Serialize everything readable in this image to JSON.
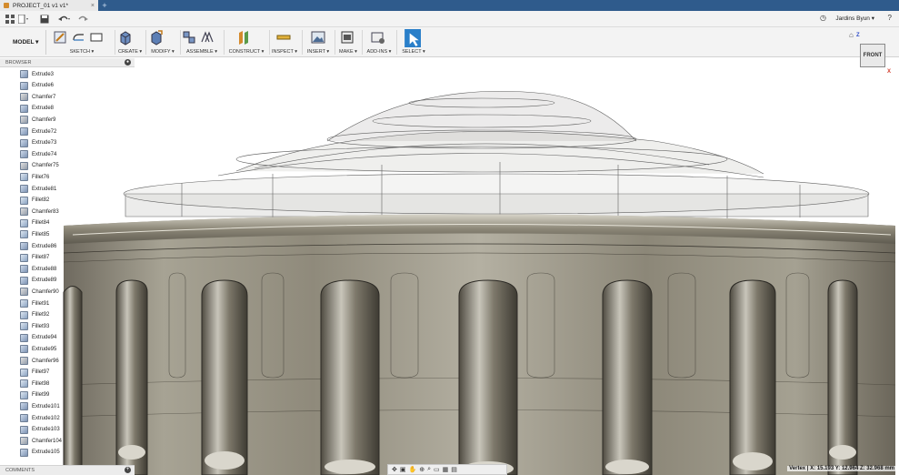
{
  "title_bar": {
    "document_tab": "PROJECT_01 v1 v1*",
    "tab_close": "×",
    "new_tab": "+"
  },
  "quick_access": {
    "user_name": "Jardins Byun ▾",
    "help": "?",
    "clock": "◷"
  },
  "ribbon": {
    "workspace": "MODEL ▾",
    "groups": [
      {
        "label": "SKETCH ▾"
      },
      {
        "label": "CREATE ▾"
      },
      {
        "label": "MODIFY ▾"
      },
      {
        "label": "ASSEMBLE ▾"
      },
      {
        "label": "CONSTRUCT ▾"
      },
      {
        "label": "INSPECT ▾"
      },
      {
        "label": "INSERT ▾"
      },
      {
        "label": "MAKE ▾"
      },
      {
        "label": "ADD-INS ▾"
      },
      {
        "label": "SELECT ▾"
      }
    ]
  },
  "browser": {
    "title": "BROWSER",
    "items": [
      {
        "label": "Extrude3",
        "kind": "extrude"
      },
      {
        "label": "Extrude6",
        "kind": "extrude"
      },
      {
        "label": "Chamfer7",
        "kind": "chamfer"
      },
      {
        "label": "Extrude8",
        "kind": "extrude"
      },
      {
        "label": "Chamfer9",
        "kind": "chamfer"
      },
      {
        "label": "Extrude72",
        "kind": "extrude"
      },
      {
        "label": "Extrude73",
        "kind": "extrude"
      },
      {
        "label": "Extrude74",
        "kind": "extrude"
      },
      {
        "label": "Chamfer75",
        "kind": "chamfer"
      },
      {
        "label": "Fillet76",
        "kind": "fillet"
      },
      {
        "label": "Extrude81",
        "kind": "extrude"
      },
      {
        "label": "Fillet82",
        "kind": "fillet"
      },
      {
        "label": "Chamfer83",
        "kind": "chamfer"
      },
      {
        "label": "Fillet84",
        "kind": "fillet"
      },
      {
        "label": "Fillet85",
        "kind": "fillet"
      },
      {
        "label": "Extrude86",
        "kind": "extrude"
      },
      {
        "label": "Fillet87",
        "kind": "fillet"
      },
      {
        "label": "Extrude88",
        "kind": "extrude"
      },
      {
        "label": "Extrude89",
        "kind": "extrude"
      },
      {
        "label": "Chamfer90",
        "kind": "chamfer"
      },
      {
        "label": "Fillet91",
        "kind": "fillet"
      },
      {
        "label": "Fillet92",
        "kind": "fillet"
      },
      {
        "label": "Fillet93",
        "kind": "fillet"
      },
      {
        "label": "Extrude94",
        "kind": "extrude"
      },
      {
        "label": "Extrude95",
        "kind": "extrude"
      },
      {
        "label": "Chamfer96",
        "kind": "chamfer"
      },
      {
        "label": "Fillet97",
        "kind": "fillet"
      },
      {
        "label": "Fillet98",
        "kind": "fillet"
      },
      {
        "label": "Fillet99",
        "kind": "fillet"
      },
      {
        "label": "Extrude101",
        "kind": "extrude"
      },
      {
        "label": "Extrude102",
        "kind": "extrude"
      },
      {
        "label": "Extrude103",
        "kind": "extrude"
      },
      {
        "label": "Chamfer104",
        "kind": "chamfer"
      },
      {
        "label": "Extrude105",
        "kind": "extrude"
      }
    ]
  },
  "comments": {
    "title": "COMMENTS",
    "add": "+"
  },
  "view_cube": {
    "face": "FRONT",
    "axis_z": "Z",
    "axis_x": "X"
  },
  "status": {
    "vertex": "Vertex | X: 15.193 Y: 12.964 Z: 32.968 mm"
  },
  "colors": {
    "title_bar": "#2f5b8c",
    "accent_select": "#2a7fc9",
    "model_metal": "#9a9585"
  }
}
